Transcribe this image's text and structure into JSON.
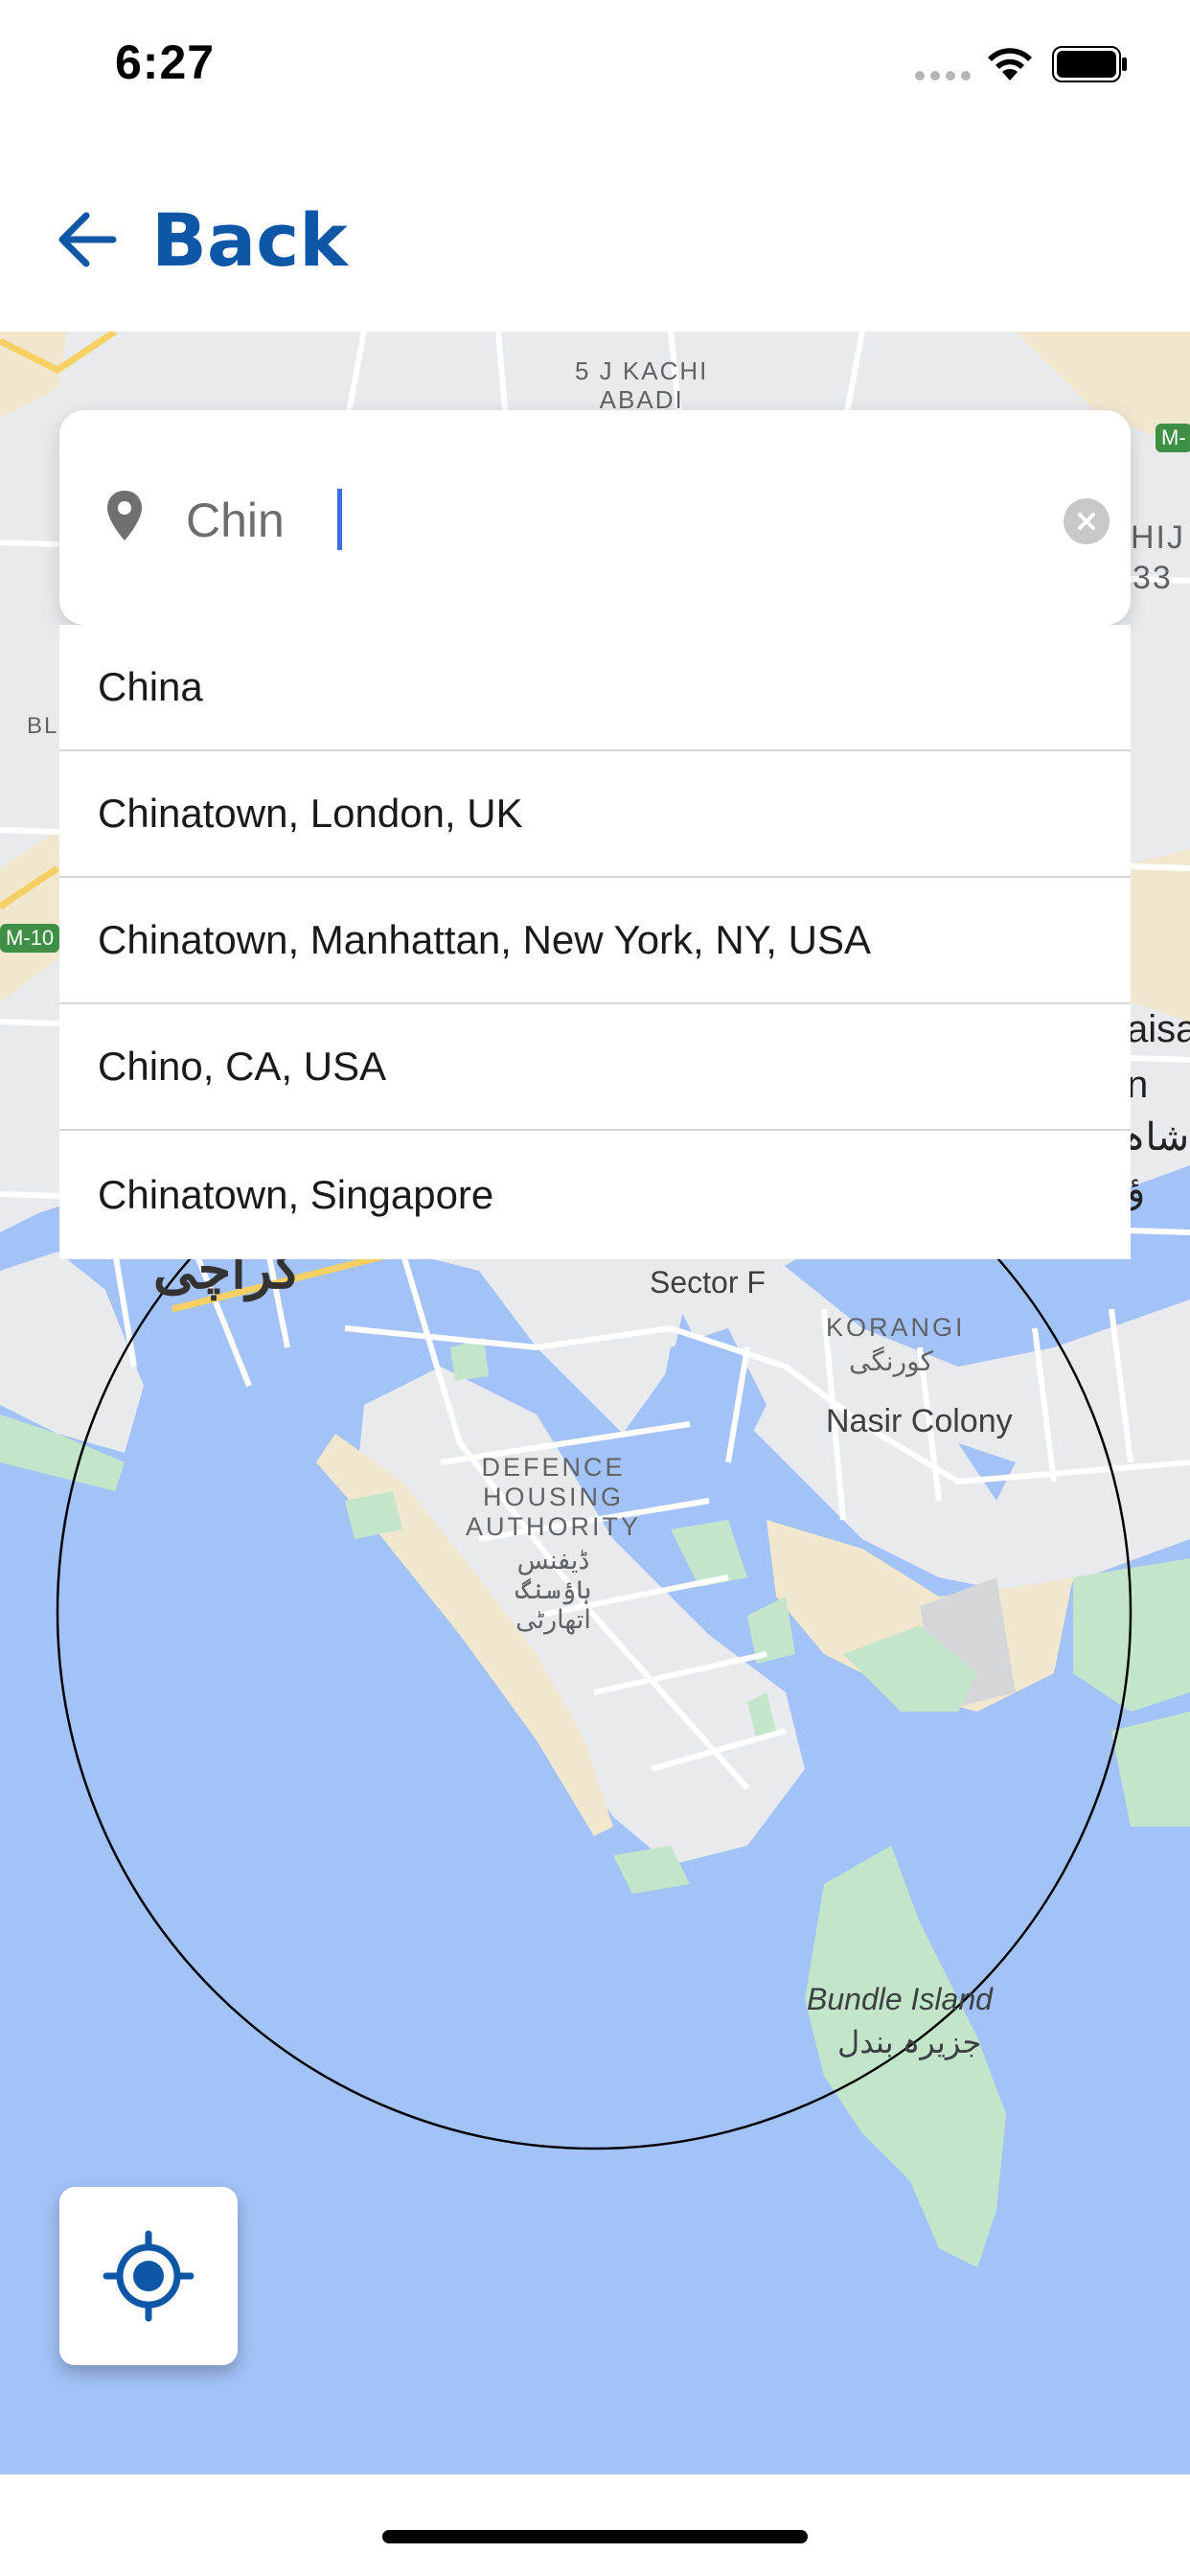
{
  "status": {
    "time": "6:27"
  },
  "nav": {
    "back_label": "Back"
  },
  "search": {
    "value": "Chin",
    "placeholder": ""
  },
  "suggestions": [
    "China",
    "Chinatown, London, UK",
    "Chinatown, Manhattan, New York, NY, USA",
    "Chino, CA, USA",
    "Chinatown, Singapore"
  ],
  "map": {
    "labels": {
      "kachi_line1": "5 J KACHI",
      "kachi_line2": "ABADI",
      "m_badge_top": "M-",
      "right_edge_top1": "HIJ",
      "right_edge_top2": "33",
      "bl": "BL",
      "m10": "M-10",
      "faisal1": "aisa",
      "faisal2": "n",
      "faisal3": "شاہ",
      "faisal4": "ؤ",
      "karachi_urdu": "کراچی",
      "sector": "Sector F",
      "korangi": "KORANGI",
      "korangi_urdu": "کورنگی",
      "nasir": "Nasir Colony",
      "dha1": "DEFENCE",
      "dha2": "HOUSING",
      "dha3": "AUTHORITY",
      "dha_urdu1": "ڈیفنس",
      "dha_urdu2": "ہاؤسنگ",
      "dha_urdu3": "اتھارٹی",
      "bundle": "Bundle Island",
      "bundle_urdu": "جزیرہ بندل"
    },
    "colors": {
      "water": "#a3c2f7",
      "land": "#e8eaed",
      "park": "#c3e6cb",
      "sand": "#f1e7cf",
      "road": "#ffffff",
      "highway": "#f6cf65"
    }
  },
  "icons": {
    "back": "arrow-left-icon",
    "pin": "location-pin-icon",
    "clear": "clear-x-icon",
    "locate": "crosshair-location-icon",
    "wifi": "wifi-icon",
    "battery": "battery-icon"
  },
  "colors": {
    "accent": "#0d57a6"
  }
}
